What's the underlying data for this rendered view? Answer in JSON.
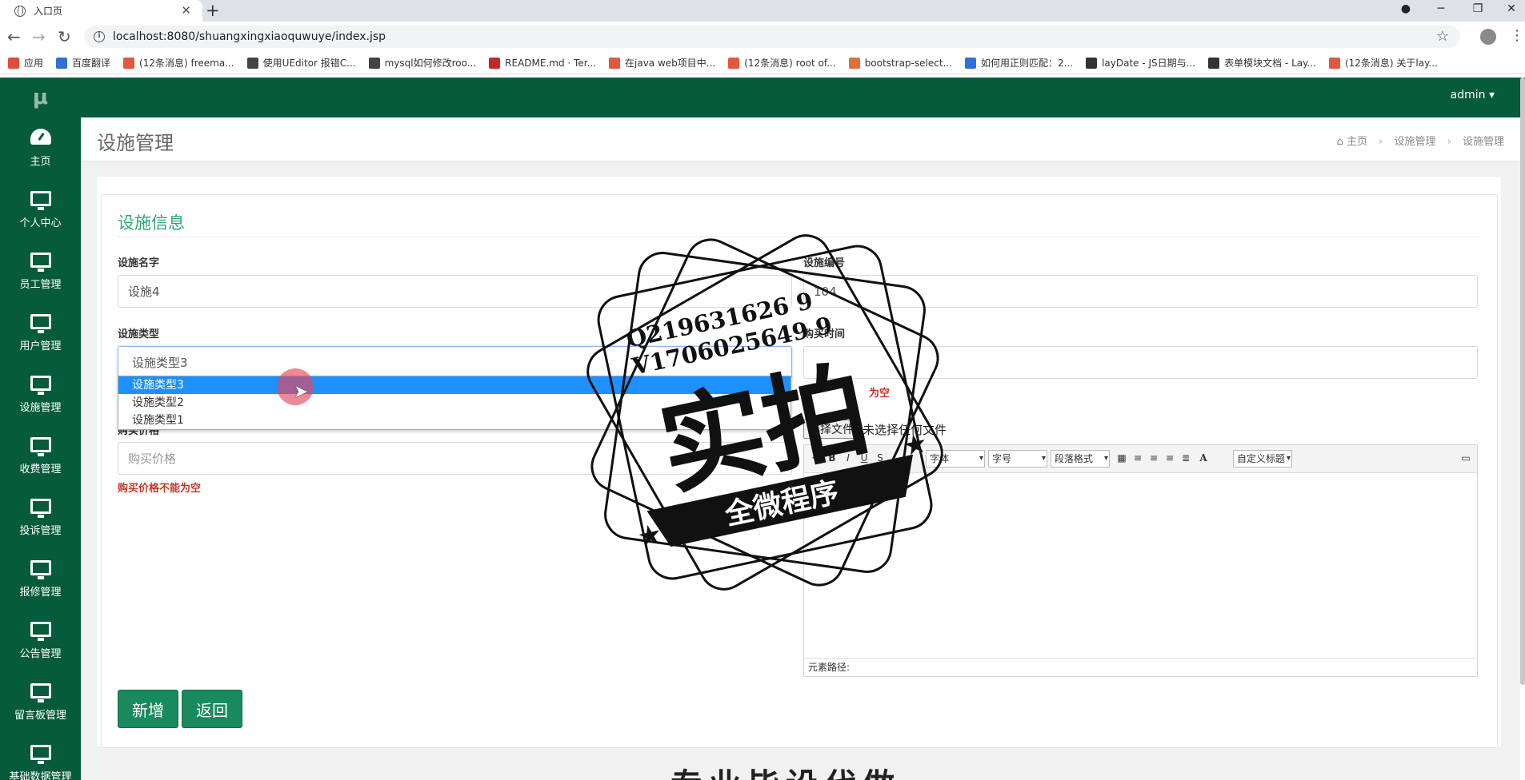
{
  "browser": {
    "tab_title": "入口页",
    "tab_close": "✕",
    "new_tab": "+",
    "url": "localhost:8080/shuangxingxiaoquwuye/index.jsp",
    "bookmarks": [
      {
        "label": "应用",
        "color": "#e24a3b"
      },
      {
        "label": "百度翻译",
        "color": "#2f6fdb"
      },
      {
        "label": "(12条消息) freema...",
        "color": "#e2583c"
      },
      {
        "label": "使用UEditor 报错C...",
        "color": "#444444"
      },
      {
        "label": "mysql如何修改roo...",
        "color": "#444444"
      },
      {
        "label": "README.md · Ter...",
        "color": "#c62828"
      },
      {
        "label": "在java web项目中...",
        "color": "#e2583c"
      },
      {
        "label": "(12条消息) root of...",
        "color": "#e2583c"
      },
      {
        "label": "bootstrap-select...",
        "color": "#e0703a"
      },
      {
        "label": "如何用正则匹配：2...",
        "color": "#2f6fdb"
      },
      {
        "label": "layDate - JS日期与...",
        "color": "#333333"
      },
      {
        "label": "表单模块文档 - Lay...",
        "color": "#333333"
      },
      {
        "label": "(12条消息) 关于lay...",
        "color": "#e2583c"
      }
    ]
  },
  "app": {
    "logo": "μ",
    "user_menu": "admin ▾",
    "sidebar": [
      {
        "label": "主页",
        "icon": "gauge-icon"
      },
      {
        "label": "个人中心",
        "icon": "monitor-icon"
      },
      {
        "label": "员工管理",
        "icon": "monitor-icon"
      },
      {
        "label": "用户管理",
        "icon": "monitor-icon"
      },
      {
        "label": "设施管理",
        "icon": "monitor-icon"
      },
      {
        "label": "收费管理",
        "icon": "monitor-icon"
      },
      {
        "label": "投诉管理",
        "icon": "monitor-icon"
      },
      {
        "label": "报修管理",
        "icon": "monitor-icon"
      },
      {
        "label": "公告管理",
        "icon": "monitor-icon"
      },
      {
        "label": "留言板管理",
        "icon": "monitor-icon"
      },
      {
        "label": "基础数据管理",
        "icon": "monitor-icon"
      }
    ],
    "page_title": "设施管理",
    "breadcrumb": [
      "主页",
      "设施管理",
      "设施管理"
    ],
    "section_title": "设施信息"
  },
  "form": {
    "name_label": "设施名字",
    "name_value": "设施4",
    "code_label": "设施编号",
    "code_value": "104",
    "type_label": "设施类型",
    "type_value": "设施类型3",
    "type_options": [
      "设施类型3",
      "设施类型2",
      "设施类型1"
    ],
    "buy_time_label": "购买时间",
    "buy_time_error": "为空",
    "price_label": "购买价格",
    "price_placeholder": "购买价格",
    "price_error": "购买价格不能为空",
    "file_button": "选择文件",
    "file_status": "未选择任何文件",
    "editor_font": "字体",
    "editor_size": "字号",
    "editor_paragraph": "段落格式",
    "editor_custom_title": "自定义标题",
    "editor_path": "元素路径:",
    "add_button": "新增",
    "back_button": "返回"
  },
  "watermark": {
    "contact_q": "Q219631626 9",
    "contact_v": "V1706025649 9",
    "main": "实拍",
    "ribbon": "全微程序",
    "bottom_text": "专业毕设代做"
  }
}
